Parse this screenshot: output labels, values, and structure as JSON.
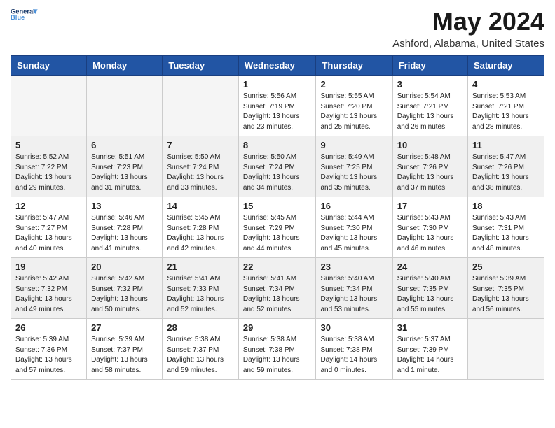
{
  "logo": {
    "line1": "General",
    "line2": "Blue"
  },
  "title": "May 2024",
  "location": "Ashford, Alabama, United States",
  "days_of_week": [
    "Sunday",
    "Monday",
    "Tuesday",
    "Wednesday",
    "Thursday",
    "Friday",
    "Saturday"
  ],
  "weeks": [
    {
      "shaded": false,
      "days": [
        {
          "num": "",
          "info": ""
        },
        {
          "num": "",
          "info": ""
        },
        {
          "num": "",
          "info": ""
        },
        {
          "num": "1",
          "info": "Sunrise: 5:56 AM\nSunset: 7:19 PM\nDaylight: 13 hours\nand 23 minutes."
        },
        {
          "num": "2",
          "info": "Sunrise: 5:55 AM\nSunset: 7:20 PM\nDaylight: 13 hours\nand 25 minutes."
        },
        {
          "num": "3",
          "info": "Sunrise: 5:54 AM\nSunset: 7:21 PM\nDaylight: 13 hours\nand 26 minutes."
        },
        {
          "num": "4",
          "info": "Sunrise: 5:53 AM\nSunset: 7:21 PM\nDaylight: 13 hours\nand 28 minutes."
        }
      ]
    },
    {
      "shaded": true,
      "days": [
        {
          "num": "5",
          "info": "Sunrise: 5:52 AM\nSunset: 7:22 PM\nDaylight: 13 hours\nand 29 minutes."
        },
        {
          "num": "6",
          "info": "Sunrise: 5:51 AM\nSunset: 7:23 PM\nDaylight: 13 hours\nand 31 minutes."
        },
        {
          "num": "7",
          "info": "Sunrise: 5:50 AM\nSunset: 7:24 PM\nDaylight: 13 hours\nand 33 minutes."
        },
        {
          "num": "8",
          "info": "Sunrise: 5:50 AM\nSunset: 7:24 PM\nDaylight: 13 hours\nand 34 minutes."
        },
        {
          "num": "9",
          "info": "Sunrise: 5:49 AM\nSunset: 7:25 PM\nDaylight: 13 hours\nand 35 minutes."
        },
        {
          "num": "10",
          "info": "Sunrise: 5:48 AM\nSunset: 7:26 PM\nDaylight: 13 hours\nand 37 minutes."
        },
        {
          "num": "11",
          "info": "Sunrise: 5:47 AM\nSunset: 7:26 PM\nDaylight: 13 hours\nand 38 minutes."
        }
      ]
    },
    {
      "shaded": false,
      "days": [
        {
          "num": "12",
          "info": "Sunrise: 5:47 AM\nSunset: 7:27 PM\nDaylight: 13 hours\nand 40 minutes."
        },
        {
          "num": "13",
          "info": "Sunrise: 5:46 AM\nSunset: 7:28 PM\nDaylight: 13 hours\nand 41 minutes."
        },
        {
          "num": "14",
          "info": "Sunrise: 5:45 AM\nSunset: 7:28 PM\nDaylight: 13 hours\nand 42 minutes."
        },
        {
          "num": "15",
          "info": "Sunrise: 5:45 AM\nSunset: 7:29 PM\nDaylight: 13 hours\nand 44 minutes."
        },
        {
          "num": "16",
          "info": "Sunrise: 5:44 AM\nSunset: 7:30 PM\nDaylight: 13 hours\nand 45 minutes."
        },
        {
          "num": "17",
          "info": "Sunrise: 5:43 AM\nSunset: 7:30 PM\nDaylight: 13 hours\nand 46 minutes."
        },
        {
          "num": "18",
          "info": "Sunrise: 5:43 AM\nSunset: 7:31 PM\nDaylight: 13 hours\nand 48 minutes."
        }
      ]
    },
    {
      "shaded": true,
      "days": [
        {
          "num": "19",
          "info": "Sunrise: 5:42 AM\nSunset: 7:32 PM\nDaylight: 13 hours\nand 49 minutes."
        },
        {
          "num": "20",
          "info": "Sunrise: 5:42 AM\nSunset: 7:32 PM\nDaylight: 13 hours\nand 50 minutes."
        },
        {
          "num": "21",
          "info": "Sunrise: 5:41 AM\nSunset: 7:33 PM\nDaylight: 13 hours\nand 52 minutes."
        },
        {
          "num": "22",
          "info": "Sunrise: 5:41 AM\nSunset: 7:34 PM\nDaylight: 13 hours\nand 52 minutes."
        },
        {
          "num": "23",
          "info": "Sunrise: 5:40 AM\nSunset: 7:34 PM\nDaylight: 13 hours\nand 53 minutes."
        },
        {
          "num": "24",
          "info": "Sunrise: 5:40 AM\nSunset: 7:35 PM\nDaylight: 13 hours\nand 55 minutes."
        },
        {
          "num": "25",
          "info": "Sunrise: 5:39 AM\nSunset: 7:35 PM\nDaylight: 13 hours\nand 56 minutes."
        }
      ]
    },
    {
      "shaded": false,
      "days": [
        {
          "num": "26",
          "info": "Sunrise: 5:39 AM\nSunset: 7:36 PM\nDaylight: 13 hours\nand 57 minutes."
        },
        {
          "num": "27",
          "info": "Sunrise: 5:39 AM\nSunset: 7:37 PM\nDaylight: 13 hours\nand 58 minutes."
        },
        {
          "num": "28",
          "info": "Sunrise: 5:38 AM\nSunset: 7:37 PM\nDaylight: 13 hours\nand 59 minutes."
        },
        {
          "num": "29",
          "info": "Sunrise: 5:38 AM\nSunset: 7:38 PM\nDaylight: 13 hours\nand 59 minutes."
        },
        {
          "num": "30",
          "info": "Sunrise: 5:38 AM\nSunset: 7:38 PM\nDaylight: 14 hours\nand 0 minutes."
        },
        {
          "num": "31",
          "info": "Sunrise: 5:37 AM\nSunset: 7:39 PM\nDaylight: 14 hours\nand 1 minute."
        },
        {
          "num": "",
          "info": ""
        }
      ]
    }
  ]
}
